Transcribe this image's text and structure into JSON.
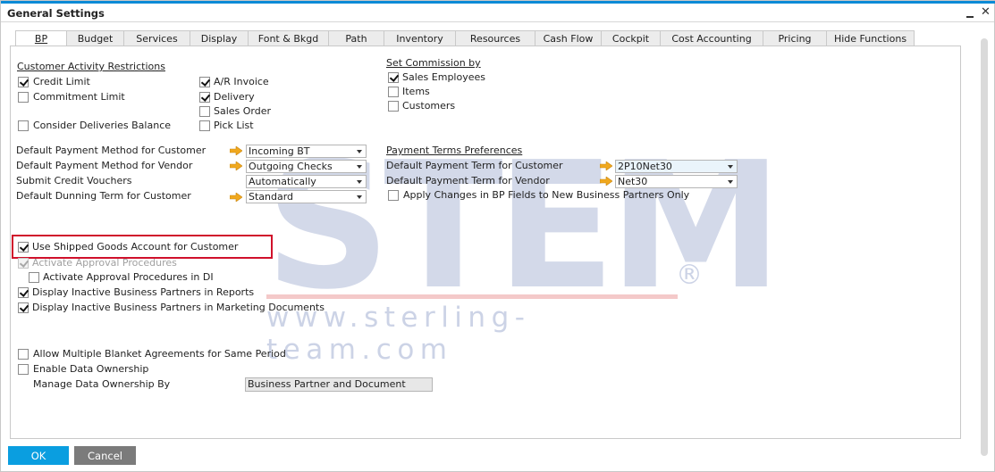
{
  "window": {
    "title": "General Settings",
    "minimize_label": "_",
    "close_label": "✕"
  },
  "tabs": [
    {
      "label": "BP",
      "active": true
    },
    {
      "label": "Budget",
      "active": false
    },
    {
      "label": "Services",
      "active": false
    },
    {
      "label": "Display",
      "active": false
    },
    {
      "label": "Font & Bkgd",
      "active": false
    },
    {
      "label": "Path",
      "active": false
    },
    {
      "label": "Inventory",
      "active": false
    },
    {
      "label": "Resources",
      "active": false
    },
    {
      "label": "Cash Flow",
      "active": false
    },
    {
      "label": "Cockpit",
      "active": false
    },
    {
      "label": "Cost Accounting",
      "active": false
    },
    {
      "label": "Pricing",
      "active": false
    },
    {
      "label": "Hide Functions",
      "active": false
    }
  ],
  "customer_activity": {
    "title": "Customer Activity Restrictions",
    "credit_limit": {
      "label": "Credit Limit",
      "checked": true
    },
    "commitment_limit": {
      "label": "Commitment Limit",
      "checked": false
    },
    "consider_deliveries_balance": {
      "label": "Consider Deliveries Balance",
      "checked": false
    },
    "ar_invoice": {
      "label": "A/R Invoice",
      "checked": true
    },
    "delivery": {
      "label": "Delivery",
      "checked": true
    },
    "sales_order": {
      "label": "Sales Order",
      "checked": false
    },
    "pick_list": {
      "label": "Pick List",
      "checked": false
    }
  },
  "commission": {
    "title": "Set Commission by",
    "sales_employees": {
      "label": "Sales Employees",
      "checked": true
    },
    "items": {
      "label": "Items",
      "checked": false
    },
    "customers": {
      "label": "Customers",
      "checked": false
    }
  },
  "payment_defaults": {
    "payment_method_customer": {
      "label": "Default Payment Method for Customer",
      "value": "Incoming BT"
    },
    "payment_method_vendor": {
      "label": "Default Payment Method for Vendor",
      "value": "Outgoing Checks"
    },
    "submit_credit_vouchers": {
      "label": "Submit Credit Vouchers",
      "value": "Automatically"
    },
    "dunning_term_customer": {
      "label": "Default Dunning Term for Customer",
      "value": "Standard"
    }
  },
  "payment_terms": {
    "title": "Payment Terms Preferences",
    "term_customer": {
      "label": "Default Payment Term for Customer",
      "value": "2P10Net30"
    },
    "term_vendor": {
      "label": "Default Payment Term for Vendor",
      "value": "Net30"
    },
    "apply_changes": {
      "label": "Apply Changes in BP Fields to New Business Partners Only",
      "checked": false
    }
  },
  "options": {
    "shipped_goods": {
      "label": "Use Shipped Goods Account for Customer",
      "checked": true
    },
    "activate_approval": {
      "label": "Activate Approval Procedures",
      "checked": true,
      "disabled": true
    },
    "activate_approval_di": {
      "label": "Activate Approval Procedures in DI",
      "checked": false
    },
    "inactive_reports": {
      "label": "Display Inactive Business Partners in Reports",
      "checked": true
    },
    "inactive_marketing": {
      "label": "Display Inactive Business Partners in Marketing Documents",
      "checked": true
    },
    "multiple_blanket": {
      "label": "Allow Multiple Blanket Agreements for Same Period",
      "checked": false
    },
    "data_ownership": {
      "label": "Enable Data Ownership",
      "checked": false
    },
    "manage_ownership": {
      "label": "Manage Data Ownership By",
      "value": "Business Partner and Document"
    }
  },
  "watermark": {
    "brand": "STEM",
    "registered": "®",
    "url": "www.sterling-team.com"
  },
  "buttons": {
    "ok": "OK",
    "cancel": "Cancel"
  },
  "colors": {
    "accent": "#0a9ee0",
    "highlight_border": "#d0112b",
    "link_arrow": "#f0a81e"
  }
}
